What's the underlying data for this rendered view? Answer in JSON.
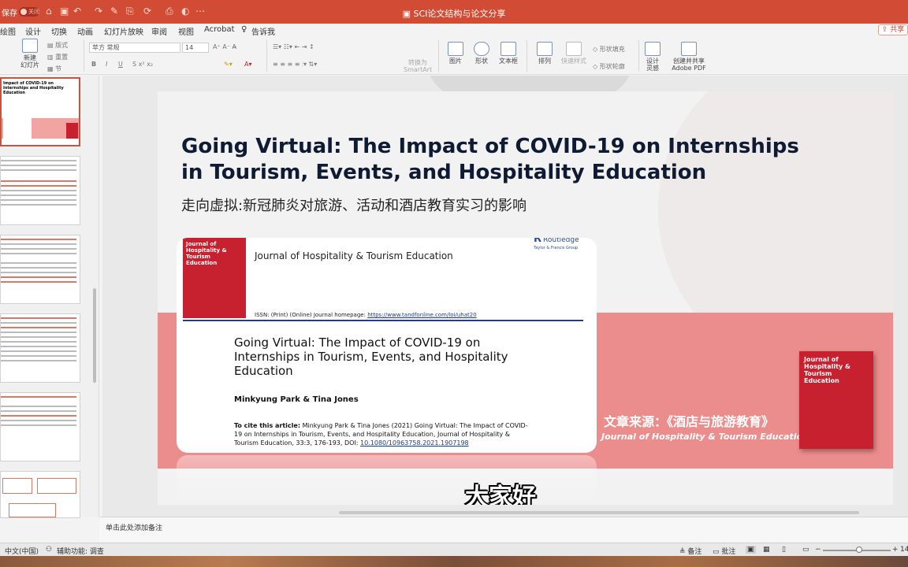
{
  "titlebar": {
    "autosave_label": "保存",
    "autosave_state": "关闭",
    "doc_title": "SCI论文结构与论文分享"
  },
  "menu": [
    "绘图",
    "设计",
    "切换",
    "动画",
    "幻灯片放映",
    "审阅",
    "视图",
    "Acrobat",
    "告诉我"
  ],
  "share_label": "共享",
  "ribbon": {
    "new_slide": "新建\n幻灯片",
    "layout": "版式",
    "reset": "重置",
    "section": "节",
    "font_name": "苹方 常规",
    "font_size": "14",
    "convert_smartart": "转换为\nSmartArt",
    "picture": "图片",
    "shapes": "形状",
    "textbox": "文本框",
    "arrange": "排列",
    "quick_styles": "快速样式",
    "shape_fill": "形状填充",
    "shape_outline": "形状轮廓",
    "design_ideas": "设计\n灵感",
    "create_pdf": "创建并共享\nAdobe PDF"
  },
  "thumbnails": {
    "first_title": "Impact of COVID-19 on Internships and Hospitality Education"
  },
  "slide": {
    "title": "Going Virtual: The Impact of COVID-19 on Internships in Tourism, Events, and Hospitality Education",
    "subtitle": "走向虚拟:新冠肺炎对旅游、活动和酒店教育实习的影响",
    "paper": {
      "cover_title": "Journal of Hospitality & Tourism Education",
      "journal": "Journal of Hospitality & Tourism Education",
      "publisher": "Routledge",
      "publisher_sub": "Taylor & Francis Group",
      "issn_text": "ISSN: (Print) (Online) Journal homepage:",
      "issn_link": "https://www.tandfonline.com/loi/uhat20",
      "title": "Going Virtual: The Impact of COVID-19 on Internships in Tourism, Events, and Hospitality Education",
      "authors": "Minkyung Park & Tina Jones",
      "cite_label": "To cite this article:",
      "citation": "Minkyung Park & Tina Jones (2021) Going Virtual: The Impact of COVID-19 on Internships in Tourism, Events, and Hospitality Education, Journal of Hospitality & Tourism Education, 33:3, 176-193, DOI:",
      "doi": "10.1080/10963758.2021.1907198"
    },
    "source_cn": "文章来源：《酒店与旅游教育》",
    "source_en": "Journal of Hospitality & Tourism Education",
    "cover_right_title": "Journal of Hospitality & Tourism Education"
  },
  "caption": "大家好",
  "notes_placeholder": "单击此处添加备注",
  "status": {
    "language": "中文(中国)",
    "accessibility": "辅助功能: 调查",
    "notes": "备注",
    "comments": "批注",
    "zoom": "14"
  },
  "colors": {
    "titlebar": "#d24c35",
    "pink_band": "#ec8d8d",
    "journal_red": "#c7202e",
    "slide_title": "#0f1a33"
  }
}
